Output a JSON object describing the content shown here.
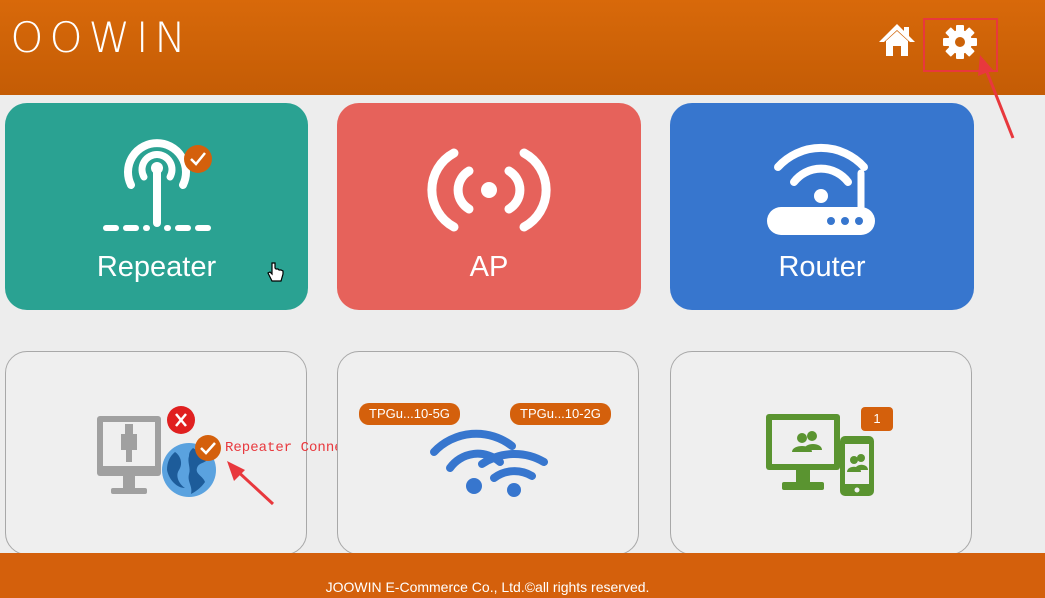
{
  "header": {
    "logo": "JOOWIN",
    "home_icon": "home-icon",
    "settings_icon": "gear-icon"
  },
  "modes": [
    {
      "label": "Repeater",
      "icon": "repeater-antenna-icon",
      "selected": true
    },
    {
      "label": "AP",
      "icon": "ap-broadcast-icon",
      "selected": false
    },
    {
      "label": "Router",
      "icon": "router-icon",
      "selected": false
    }
  ],
  "status": {
    "connection_text": "Repeater Connected",
    "networks": [
      "TPGu...10-5G",
      "TPGu...10-2G"
    ],
    "clients_count": "1"
  },
  "footer": {
    "copyright": "JOOWIN E-Commerce Co., Ltd.©all rights reserved."
  },
  "colors": {
    "brand_orange": "#d4600c",
    "repeater": "#2aa292",
    "ap": "#e6625b",
    "router": "#3776ce",
    "annotation_red": "#e8383d"
  }
}
